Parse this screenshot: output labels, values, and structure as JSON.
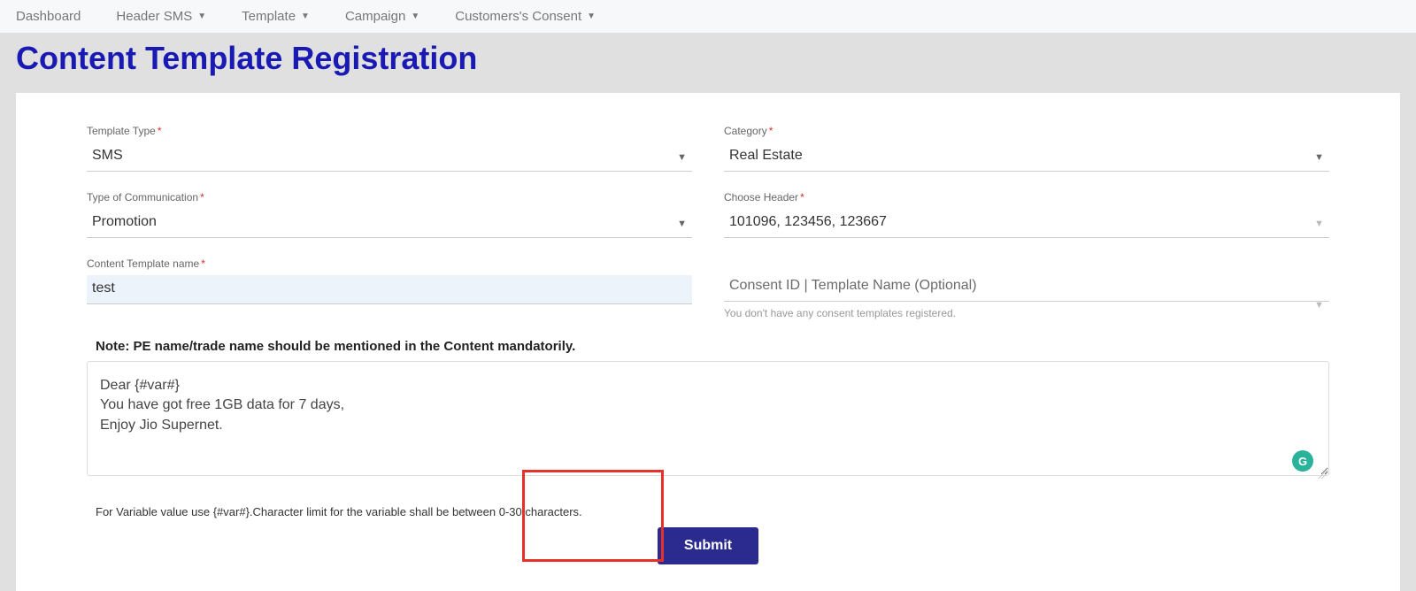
{
  "nav": {
    "items": [
      {
        "label": "Dashboard",
        "hasDropdown": false
      },
      {
        "label": "Header SMS",
        "hasDropdown": true
      },
      {
        "label": "Template",
        "hasDropdown": true
      },
      {
        "label": "Campaign",
        "hasDropdown": true
      },
      {
        "label": "Customers's Consent",
        "hasDropdown": true
      }
    ]
  },
  "page": {
    "title": "Content Template Registration"
  },
  "form": {
    "templateType": {
      "label": "Template Type",
      "value": "SMS"
    },
    "category": {
      "label": "Category",
      "value": "Real Estate"
    },
    "commType": {
      "label": "Type of Communication",
      "value": "Promotion"
    },
    "header": {
      "label": "Choose Header",
      "value": "101096, 123456, 123667"
    },
    "templateName": {
      "label": "Content Template name",
      "value": "test"
    },
    "consent": {
      "placeholder": "Consent ID | Template Name (Optional)",
      "helper": "You don't have any consent templates registered."
    },
    "note": "Note: PE name/trade name should be mentioned in the Content mandatorily.",
    "content": "Dear {#var#}\nYou have got free 1GB data for 7 days,\nEnjoy Jio Supernet.",
    "varHint": "For Variable value use {#var#}.Character limit for the variable shall be between 0-30 characters.",
    "submitLabel": "Submit"
  },
  "icons": {
    "grammarly": "G"
  }
}
